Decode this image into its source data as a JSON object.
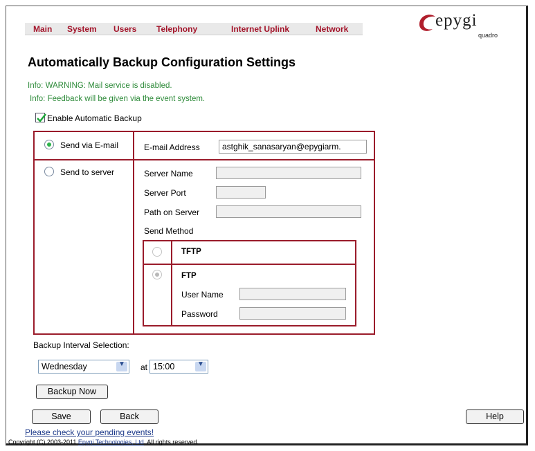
{
  "menu": [
    "Main",
    "System",
    "Users",
    "Telephony",
    "Internet Uplink",
    "Network"
  ],
  "logo": {
    "brand": "epygi",
    "subtitle": "quadro"
  },
  "page_title": "Automatically Backup Configuration Settings",
  "info": {
    "warning": "Info: WARNING: Mail service is disabled.",
    "feedback": "Info: Feedback will be given via the event system."
  },
  "enable_backup": {
    "label": "Enable Automatic Backup",
    "checked": true
  },
  "send_email": {
    "label": "Send via E-mail",
    "email_label": "E-mail Address",
    "email_value": "astghik_sanasaryan@epygiarm."
  },
  "send_server": {
    "label": "Send to server",
    "server_name_label": "Server Name",
    "server_port_label": "Server Port",
    "path_label": "Path on Server",
    "send_method_label": "Send Method",
    "tftp_label": "TFTP",
    "ftp_label": "FTP",
    "user_name_label": "User Name",
    "password_label": "Password"
  },
  "interval": {
    "label": "Backup Interval Selection:",
    "day": "Wednesday",
    "at_label": "at",
    "time": "15:00"
  },
  "buttons": {
    "backup_now": "Backup Now",
    "save": "Save",
    "back": "Back",
    "help": "Help"
  },
  "pending_link": "Please check your pending events!",
  "footer": {
    "prefix": "Copyright (C) 2003-2011 ",
    "company": "Epygi Technologies, Ltd",
    "suffix": ". All rights reserved."
  },
  "colors": {
    "menu_text": "#a3142a",
    "frame_red": "#9a1b2a",
    "info_green": "#2e8b3a",
    "link_blue": "#1d3a8a"
  }
}
